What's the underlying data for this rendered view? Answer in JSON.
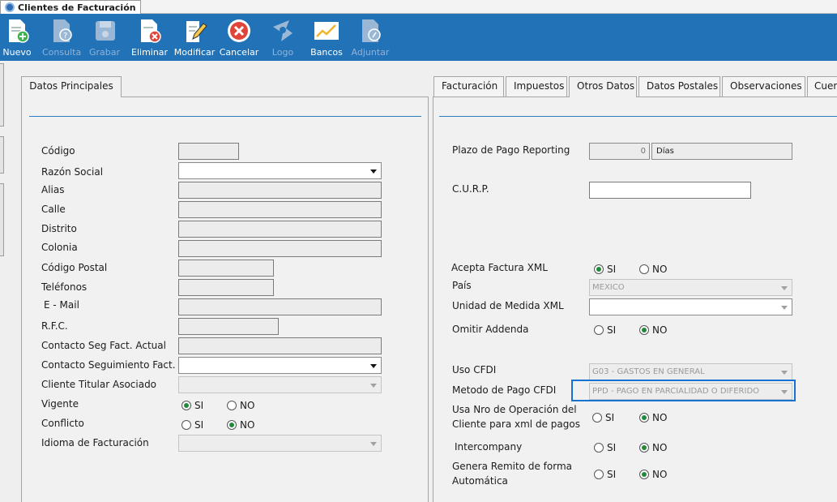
{
  "window": {
    "title": "Clientes de Facturación"
  },
  "toolbar": {
    "nuevo": "Nuevo",
    "consulta": "Consulta",
    "grabar": "Grabar",
    "eliminar": "Eliminar",
    "modificar": "Modificar",
    "cancelar": "Cancelar",
    "logo": "Logo",
    "bancos": "Bancos",
    "adjuntar": "Adjuntar"
  },
  "left_panel": {
    "tab": "Datos Principales",
    "fields": {
      "codigo": "Código",
      "razon_social": "Razón Social",
      "alias": "Alias",
      "calle": "Calle",
      "distrito": "Distrito",
      "colonia": "Colonia",
      "codigo_postal": "Código Postal",
      "telefonos": "Teléfonos",
      "email": "E - Mail",
      "rfc": "R.F.C.",
      "contacto_seg_actual": "Contacto Seg Fact. Actual",
      "contacto_seguimiento": "Contacto Seguimiento Fact.",
      "cliente_titular": "Cliente Titular Asociado",
      "vigente": "Vigente",
      "conflicto": "Conflicto",
      "idioma": "Idioma de Facturación"
    },
    "vigente_selected": "SI",
    "conflicto_selected": "NO"
  },
  "right_panel": {
    "tabs": [
      "Facturación",
      "Impuestos",
      "Otros Datos",
      "Datos Postales",
      "Observaciones",
      "Cuen"
    ],
    "active_tab": "Otros Datos",
    "plazo_label": "Plazo de Pago Reporting",
    "plazo_value": "0",
    "plazo_unit": "Días",
    "curp_label": "C.U.R.P.",
    "acepta_xml_label": "Acepta Factura XML",
    "acepta_xml_selected": "SI",
    "pais_label": "País",
    "pais_value": "MEXICO",
    "unidad_label": "Unidad de Medida XML",
    "unidad_value": "",
    "omitir_label": "Omitir Addenda",
    "omitir_selected": "NO",
    "uso_cfdi_label": "Uso CFDI",
    "uso_cfdi_value": "G03 - GASTOS EN GENERAL",
    "metodo_label": "Metodo de Pago CFDI",
    "metodo_value": "PPD - PAGO EN PARCIALIDAD O DIFERIDO",
    "usa_nro_label_1": "Usa Nro de Operación del",
    "usa_nro_label_2": "Cliente para xml de pagos",
    "usa_nro_selected": "NO",
    "intercompany_label": "Intercompany",
    "intercompany_selected": "NO",
    "genera_label_1": "Genera Remito de forma",
    "genera_label_2": "Automática",
    "genera_selected": "NO"
  },
  "radio": {
    "si": "SI",
    "no": "NO"
  },
  "colors": {
    "toolbar": "#2272b8",
    "accent": "#2d7dc3",
    "focus": "#1673d0",
    "radio_on": "#208a3a"
  }
}
